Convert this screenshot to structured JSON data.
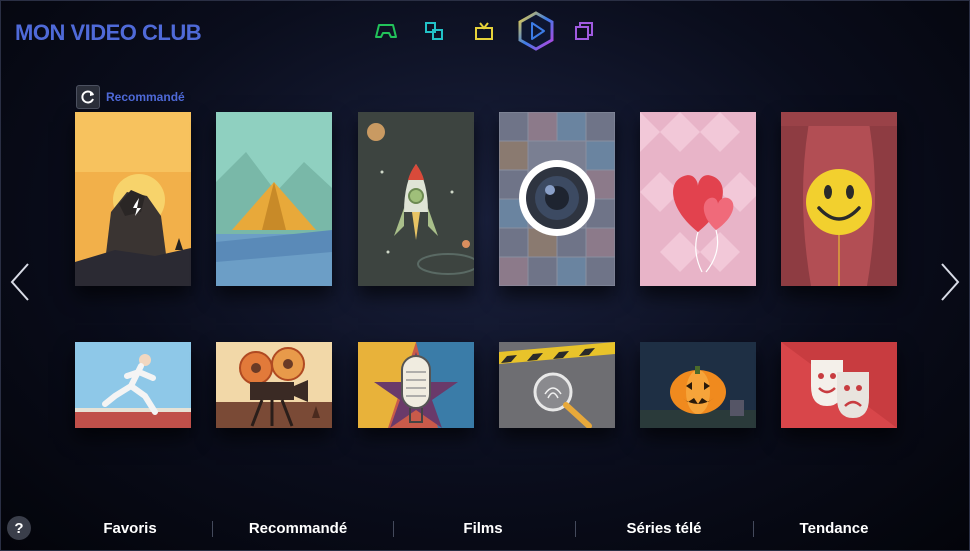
{
  "app": {
    "title": "MON VIDEO CLUB"
  },
  "top_nav": [
    {
      "name": "games-icon",
      "color": "#22c25a",
      "selected": false
    },
    {
      "name": "apps-icon",
      "color": "#22c2c8",
      "selected": false
    },
    {
      "name": "tv-icon",
      "color": "#e6d23a",
      "selected": false
    },
    {
      "name": "play-icon",
      "color": "#3c7ce6",
      "selected": true
    },
    {
      "name": "multiscreen-icon",
      "color": "#a05ae0",
      "selected": false
    }
  ],
  "section": {
    "label": "Recommandé",
    "icon": "refresh-icon"
  },
  "row1_tiles": [
    {
      "name": "tile-gorilla-sunset",
      "icon": "gorilla-icon"
    },
    {
      "name": "tile-tent",
      "icon": "tent-icon"
    },
    {
      "name": "tile-rocket",
      "icon": "rocket-icon"
    },
    {
      "name": "tile-camera-lens",
      "icon": "lens-icon"
    },
    {
      "name": "tile-heart-balloons",
      "icon": "heart-icon"
    },
    {
      "name": "tile-smiley-curtain",
      "icon": "smiley-icon"
    }
  ],
  "row2_tiles": [
    {
      "name": "tile-runner",
      "icon": "runner-icon"
    },
    {
      "name": "tile-film-camera",
      "icon": "film-camera-icon"
    },
    {
      "name": "tile-microphone",
      "icon": "microphone-icon"
    },
    {
      "name": "tile-fingerprint",
      "icon": "fingerprint-icon"
    },
    {
      "name": "tile-pumpkin",
      "icon": "pumpkin-icon"
    },
    {
      "name": "tile-theater-masks",
      "icon": "masks-icon"
    }
  ],
  "bottom_nav": {
    "help": "?",
    "items": [
      "Favoris",
      "Recommandé",
      "Films",
      "Séries télé",
      "Tendance"
    ]
  },
  "colors": {
    "accent": "#4f6ad8",
    "background": "#0a0d1c"
  }
}
